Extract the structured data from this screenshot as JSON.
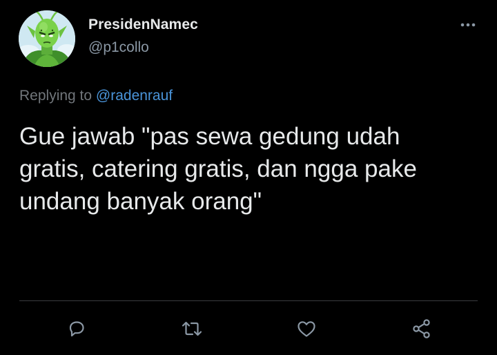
{
  "author": {
    "display_name": "PresidenNamec",
    "handle": "@p1collo",
    "avatar_icon": "green-character-avatar"
  },
  "reply": {
    "prefix": "Replying to",
    "to_handle": "@radenrauf"
  },
  "tweet": {
    "line1": "Gue jawab \"pas sewa gedung udah",
    "line2": "gratis, catering gratis, dan ngga pake",
    "line3": "undang banyak orang\""
  },
  "icons": {
    "more": "more-options-icon",
    "reply": "reply-icon",
    "retweet": "retweet-icon",
    "like": "like-icon",
    "share": "share-icon"
  },
  "colors": {
    "background": "#000000",
    "primary_text": "#e7e9ea",
    "secondary_text": "#71767b",
    "link": "#4a94d9",
    "icon": "#8b98a5"
  }
}
